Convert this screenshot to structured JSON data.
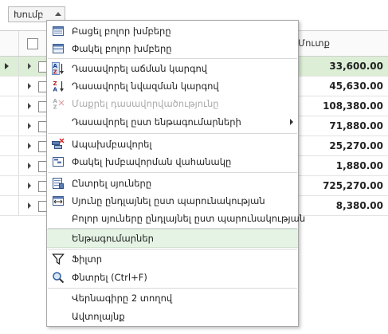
{
  "group_panel": {
    "tag_label": "Խումբ"
  },
  "grid": {
    "header": {
      "amount_label": "Մուտք"
    },
    "rows": [
      {
        "amount": "33,600.00",
        "selected": true
      },
      {
        "amount": "45,630.00"
      },
      {
        "amount": "108,380.00"
      },
      {
        "amount": "71,880.00"
      },
      {
        "amount": "25,270.00"
      },
      {
        "amount": "1,880.00"
      },
      {
        "amount": "725,270.00"
      },
      {
        "amount": "8,380.00"
      }
    ]
  },
  "menu": {
    "items": [
      {
        "label": "Բացել բոլոր խմբերը",
        "icon": "expand-all-icon"
      },
      {
        "label": "Փակել բոլոր խմբերը",
        "icon": "collapse-all-icon"
      },
      {
        "label": "Դասավորել աճման կարգով",
        "icon": "sort-ascending-icon"
      },
      {
        "label": "Դասավորել նվազման կարգով",
        "icon": "sort-descending-icon"
      },
      {
        "label": "Մաքրել դասավորվածությունը",
        "icon": "clear-sorting-icon",
        "disabled": true
      },
      {
        "label": "Դասավորել ըստ ենթագումարների",
        "submenu": true
      },
      {
        "label": "Ապախմբավորել",
        "icon": "ungroup-icon"
      },
      {
        "label": "Փակել խմբավորման վահանակը",
        "icon": "hide-group-panel-icon"
      },
      {
        "label": "Ընտրել սյուները",
        "icon": "column-chooser-icon"
      },
      {
        "label": "Սյունը ընդլայնել ըստ պարունակության",
        "icon": "best-fit-icon"
      },
      {
        "label": "Բոլոր սյուները ընդլայնել ըստ պարունակության"
      },
      {
        "label": "Ենթագումարներ",
        "highlighted": true
      },
      {
        "label": "Ֆիլտր",
        "icon": "filter-icon"
      },
      {
        "label": "Փնտրել (Ctrl+F)",
        "icon": "search-icon"
      },
      {
        "label": "Վերնագիրը 2 տողով"
      },
      {
        "label": "Ավտոլայնք"
      }
    ]
  },
  "colors": {
    "selected_row": "#dcefd6",
    "menu_highlight": "#e5f3e5"
  }
}
